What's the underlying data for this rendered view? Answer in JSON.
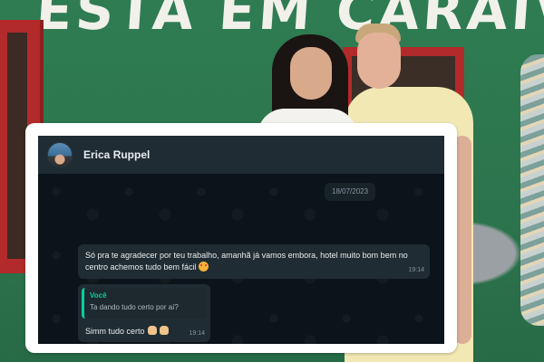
{
  "background": {
    "sign_text": "ESTA EM CARAÍVA"
  },
  "chat": {
    "contact_name": "Erica Ruppel",
    "date": "18/07/2023",
    "messages": [
      {
        "text": "Só pra te agradecer por teu trabalho, amanhã já vamos embora, hotel muito bom bem no centro achemos tudo bem fácil",
        "time": "19:14"
      },
      {
        "quote_author": "Você",
        "quote_text": "Ta dando tudo certo por aí?",
        "text": "Simm tudo certo",
        "time": "19:14"
      }
    ]
  },
  "colors": {
    "header_bg": "#1f2c34",
    "chat_bg": "#0b141a",
    "bubble_bg": "#202c33",
    "quote_accent": "#06cf9c",
    "wall_green": "#2f7a52"
  }
}
